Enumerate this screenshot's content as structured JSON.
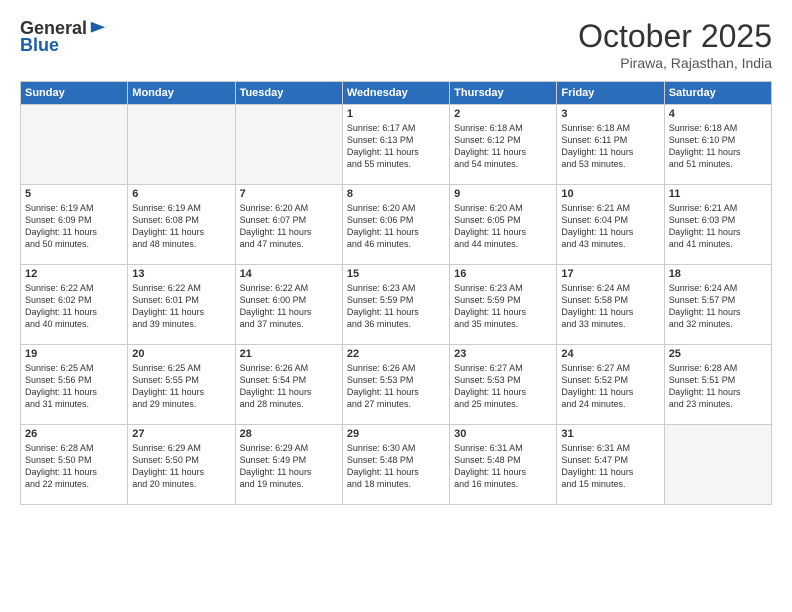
{
  "header": {
    "logo_line1": "General",
    "logo_line2": "Blue",
    "month": "October 2025",
    "location": "Pirawa, Rajasthan, India"
  },
  "weekdays": [
    "Sunday",
    "Monday",
    "Tuesday",
    "Wednesday",
    "Thursday",
    "Friday",
    "Saturday"
  ],
  "weeks": [
    [
      {
        "day": "",
        "info": ""
      },
      {
        "day": "",
        "info": ""
      },
      {
        "day": "",
        "info": ""
      },
      {
        "day": "1",
        "info": "Sunrise: 6:17 AM\nSunset: 6:13 PM\nDaylight: 11 hours\nand 55 minutes."
      },
      {
        "day": "2",
        "info": "Sunrise: 6:18 AM\nSunset: 6:12 PM\nDaylight: 11 hours\nand 54 minutes."
      },
      {
        "day": "3",
        "info": "Sunrise: 6:18 AM\nSunset: 6:11 PM\nDaylight: 11 hours\nand 53 minutes."
      },
      {
        "day": "4",
        "info": "Sunrise: 6:18 AM\nSunset: 6:10 PM\nDaylight: 11 hours\nand 51 minutes."
      }
    ],
    [
      {
        "day": "5",
        "info": "Sunrise: 6:19 AM\nSunset: 6:09 PM\nDaylight: 11 hours\nand 50 minutes."
      },
      {
        "day": "6",
        "info": "Sunrise: 6:19 AM\nSunset: 6:08 PM\nDaylight: 11 hours\nand 48 minutes."
      },
      {
        "day": "7",
        "info": "Sunrise: 6:20 AM\nSunset: 6:07 PM\nDaylight: 11 hours\nand 47 minutes."
      },
      {
        "day": "8",
        "info": "Sunrise: 6:20 AM\nSunset: 6:06 PM\nDaylight: 11 hours\nand 46 minutes."
      },
      {
        "day": "9",
        "info": "Sunrise: 6:20 AM\nSunset: 6:05 PM\nDaylight: 11 hours\nand 44 minutes."
      },
      {
        "day": "10",
        "info": "Sunrise: 6:21 AM\nSunset: 6:04 PM\nDaylight: 11 hours\nand 43 minutes."
      },
      {
        "day": "11",
        "info": "Sunrise: 6:21 AM\nSunset: 6:03 PM\nDaylight: 11 hours\nand 41 minutes."
      }
    ],
    [
      {
        "day": "12",
        "info": "Sunrise: 6:22 AM\nSunset: 6:02 PM\nDaylight: 11 hours\nand 40 minutes."
      },
      {
        "day": "13",
        "info": "Sunrise: 6:22 AM\nSunset: 6:01 PM\nDaylight: 11 hours\nand 39 minutes."
      },
      {
        "day": "14",
        "info": "Sunrise: 6:22 AM\nSunset: 6:00 PM\nDaylight: 11 hours\nand 37 minutes."
      },
      {
        "day": "15",
        "info": "Sunrise: 6:23 AM\nSunset: 5:59 PM\nDaylight: 11 hours\nand 36 minutes."
      },
      {
        "day": "16",
        "info": "Sunrise: 6:23 AM\nSunset: 5:59 PM\nDaylight: 11 hours\nand 35 minutes."
      },
      {
        "day": "17",
        "info": "Sunrise: 6:24 AM\nSunset: 5:58 PM\nDaylight: 11 hours\nand 33 minutes."
      },
      {
        "day": "18",
        "info": "Sunrise: 6:24 AM\nSunset: 5:57 PM\nDaylight: 11 hours\nand 32 minutes."
      }
    ],
    [
      {
        "day": "19",
        "info": "Sunrise: 6:25 AM\nSunset: 5:56 PM\nDaylight: 11 hours\nand 31 minutes."
      },
      {
        "day": "20",
        "info": "Sunrise: 6:25 AM\nSunset: 5:55 PM\nDaylight: 11 hours\nand 29 minutes."
      },
      {
        "day": "21",
        "info": "Sunrise: 6:26 AM\nSunset: 5:54 PM\nDaylight: 11 hours\nand 28 minutes."
      },
      {
        "day": "22",
        "info": "Sunrise: 6:26 AM\nSunset: 5:53 PM\nDaylight: 11 hours\nand 27 minutes."
      },
      {
        "day": "23",
        "info": "Sunrise: 6:27 AM\nSunset: 5:53 PM\nDaylight: 11 hours\nand 25 minutes."
      },
      {
        "day": "24",
        "info": "Sunrise: 6:27 AM\nSunset: 5:52 PM\nDaylight: 11 hours\nand 24 minutes."
      },
      {
        "day": "25",
        "info": "Sunrise: 6:28 AM\nSunset: 5:51 PM\nDaylight: 11 hours\nand 23 minutes."
      }
    ],
    [
      {
        "day": "26",
        "info": "Sunrise: 6:28 AM\nSunset: 5:50 PM\nDaylight: 11 hours\nand 22 minutes."
      },
      {
        "day": "27",
        "info": "Sunrise: 6:29 AM\nSunset: 5:50 PM\nDaylight: 11 hours\nand 20 minutes."
      },
      {
        "day": "28",
        "info": "Sunrise: 6:29 AM\nSunset: 5:49 PM\nDaylight: 11 hours\nand 19 minutes."
      },
      {
        "day": "29",
        "info": "Sunrise: 6:30 AM\nSunset: 5:48 PM\nDaylight: 11 hours\nand 18 minutes."
      },
      {
        "day": "30",
        "info": "Sunrise: 6:31 AM\nSunset: 5:48 PM\nDaylight: 11 hours\nand 16 minutes."
      },
      {
        "day": "31",
        "info": "Sunrise: 6:31 AM\nSunset: 5:47 PM\nDaylight: 11 hours\nand 15 minutes."
      },
      {
        "day": "",
        "info": ""
      }
    ]
  ]
}
